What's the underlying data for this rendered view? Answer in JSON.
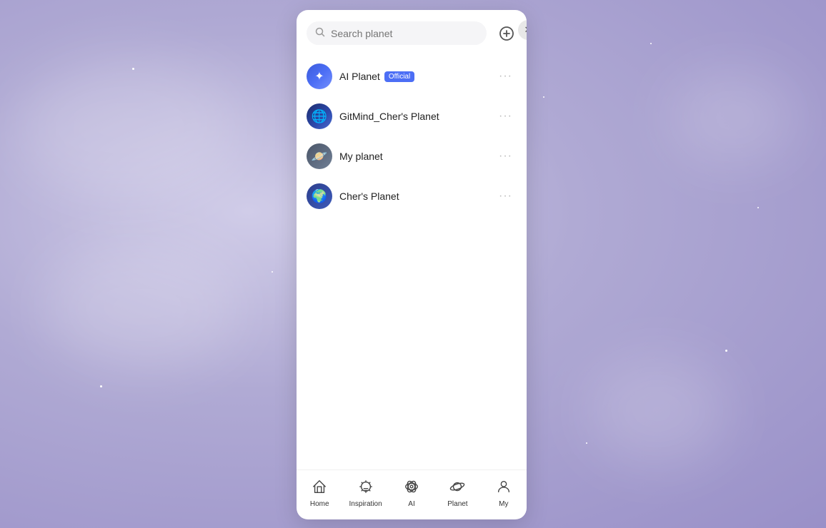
{
  "background": {
    "color": "#b0aad4"
  },
  "panel": {
    "close_label": "✕",
    "expand_label": "▶"
  },
  "search": {
    "placeholder": "Search planet"
  },
  "add_button": {
    "label": "+"
  },
  "planets": [
    {
      "id": "ai-planet",
      "name": "AI Planet",
      "badge": "Official",
      "avatar_type": "ai",
      "more": "···"
    },
    {
      "id": "gitmind-planet",
      "name": "GitMind_Cher's Planet",
      "badge": null,
      "avatar_type": "gitmind",
      "more": "···"
    },
    {
      "id": "my-planet",
      "name": "My planet",
      "badge": null,
      "avatar_type": "myplanet",
      "more": "···"
    },
    {
      "id": "chers-planet",
      "name": "Cher's Planet",
      "badge": null,
      "avatar_type": "chers",
      "more": "···"
    }
  ],
  "nav": {
    "items": [
      {
        "id": "home",
        "label": "Home",
        "icon": "home"
      },
      {
        "id": "inspiration",
        "label": "Inspiration",
        "icon": "bulb"
      },
      {
        "id": "ai",
        "label": "AI",
        "icon": "ai"
      },
      {
        "id": "planet",
        "label": "Planet",
        "icon": "planet"
      },
      {
        "id": "my",
        "label": "My",
        "icon": "person"
      }
    ]
  }
}
